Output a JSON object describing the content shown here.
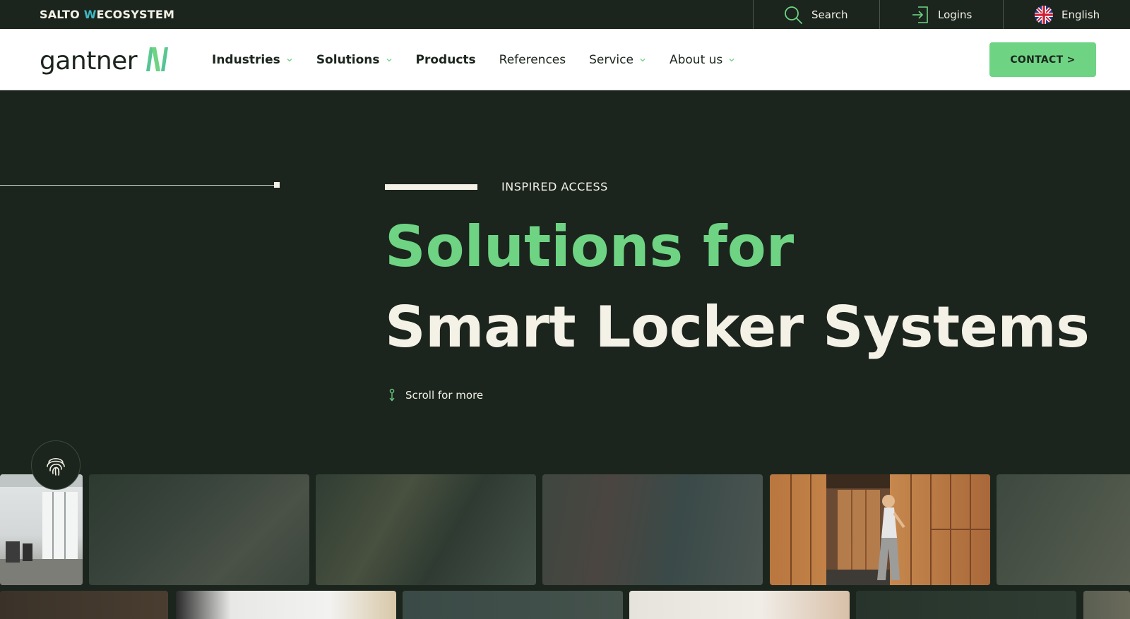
{
  "topbar": {
    "brand_prefix": "SALTO ",
    "brand_mark": "W",
    "brand_suffix": "ECOSYSTEM",
    "search_label": "Search",
    "logins_label": "Logins",
    "language_label": "English"
  },
  "nav": {
    "logo_text": "gantner",
    "items": [
      {
        "label": "Industries"
      },
      {
        "label": "Solutions"
      },
      {
        "label": "Products"
      },
      {
        "label": "References"
      },
      {
        "label": "Service"
      },
      {
        "label": "About us"
      }
    ],
    "contact_label": "CONTACT >"
  },
  "hero": {
    "eyebrow": "INSPIRED ACCESS",
    "headline_line1": "Solutions for",
    "headline_line2": "Smart Locker Systems",
    "scroll_label": "Scroll for more"
  },
  "colors": {
    "background": "#1b251d",
    "accent_green": "#6ed383",
    "cream": "#f4f1e6",
    "salto_mark": "#3fb8c4"
  },
  "icons": {
    "search": "search-icon",
    "logins": "login-icon",
    "language": "uk-flag-icon",
    "scroll": "scroll-indicator-icon",
    "fingerprint": "fingerprint-icon",
    "chevron": "chevron-down-icon"
  }
}
